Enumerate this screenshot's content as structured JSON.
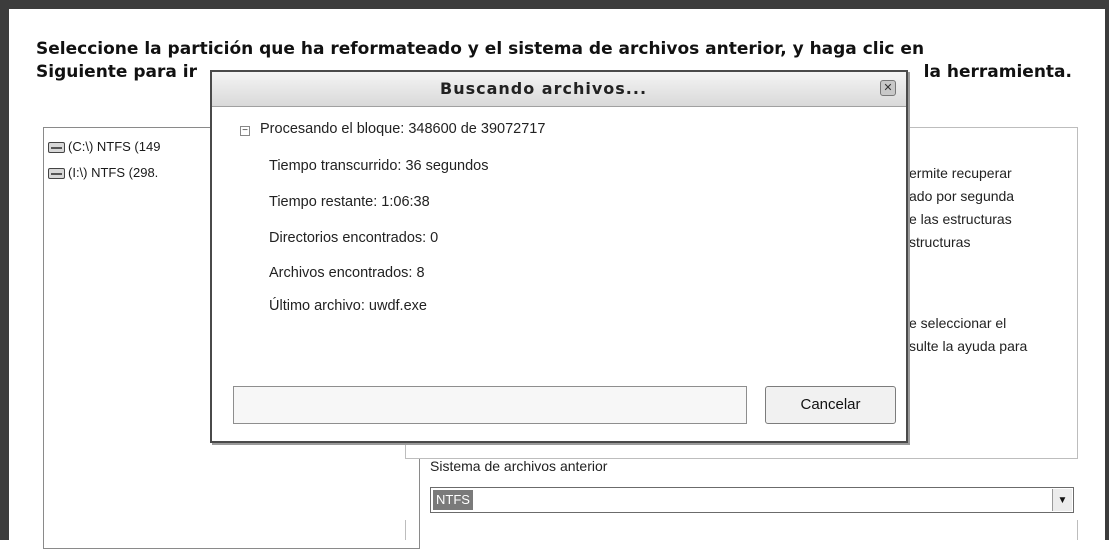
{
  "instruction": {
    "line1": "Seleccione la partición que ha reformateado y el sistema de archivos anterior, y haga clic en",
    "line2_start": "Siguiente para ir",
    "line2_end": "la herramienta."
  },
  "partitions": [
    {
      "label": "(C:\\) NTFS (149"
    },
    {
      "label": "(I:\\) NTFS (298."
    }
  ],
  "description": {
    "line1": "ermite recuperar",
    "line2": "ado por segunda",
    "line3": "e las estructuras",
    "line4": "structuras",
    "line5": "e seleccionar el",
    "line6": "sulte la ayuda para"
  },
  "fs": {
    "label": "Sistema de archivos anterior",
    "value": "NTFS"
  },
  "dialog": {
    "title": "Buscando archivos...",
    "processing": "Procesando el bloque: 348600 de 39072717",
    "elapsed": "Tiempo transcurrido: 36 segundos",
    "remaining": "Tiempo restante: 1:06:38",
    "dirs": "Directorios encontrados: 0",
    "files": "Archivos encontrados: 8",
    "last_file": "Último archivo: uwdf.exe",
    "progress": 0,
    "cancel_label": "Cancelar"
  },
  "icons": {
    "drive": "hard-drive-icon",
    "close": "close-icon",
    "collapse": "minus-box-icon",
    "dropdown": "chevron-down-icon"
  },
  "colors": {
    "dialog_title_bg": "#d9d9d9",
    "selection_bg": "#7a7a7a"
  }
}
